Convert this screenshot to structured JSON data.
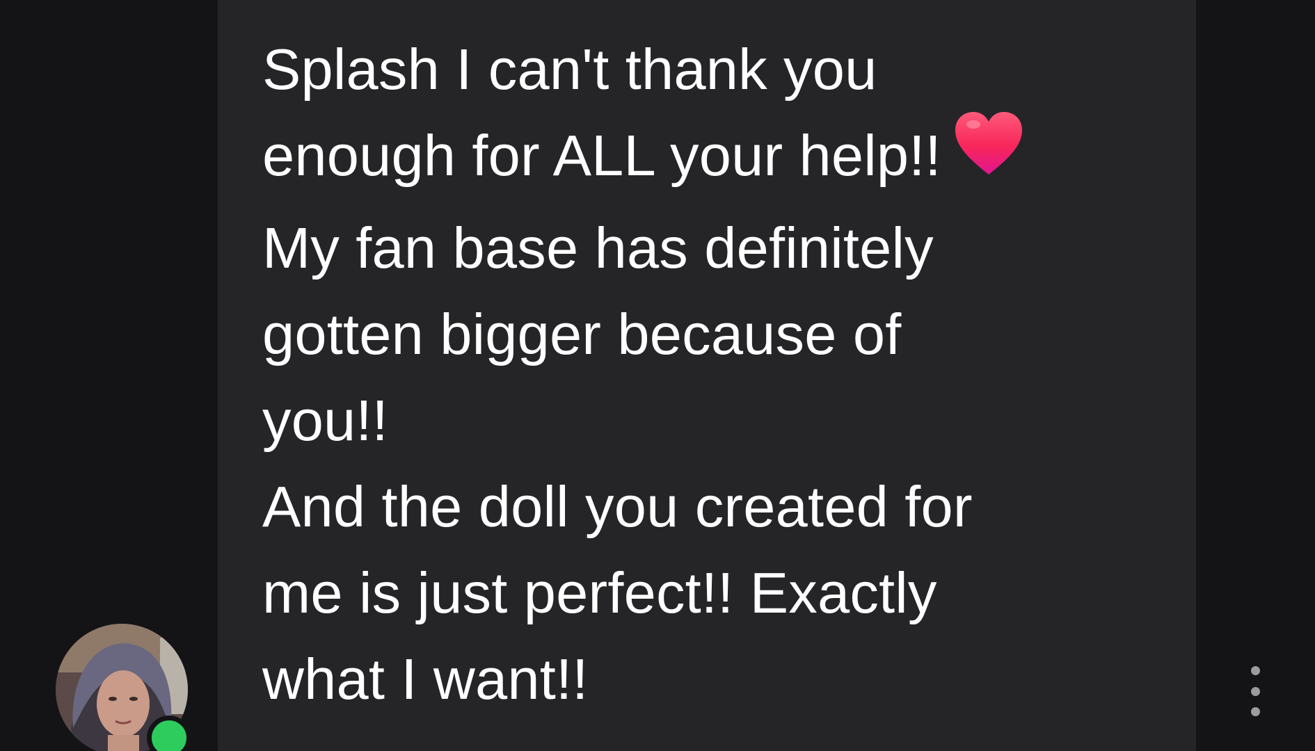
{
  "message": {
    "lines": [
      "Splash I can't thank you",
      "enough for ALL your help!!",
      "My fan base has definitely",
      "gotten bigger because of",
      "you!!",
      "And the doll you created for",
      "me is just perfect!! Exactly",
      "what I want!!"
    ],
    "emoji": "red-heart-icon"
  },
  "sender": {
    "avatar_icon": "user-avatar",
    "online_status_color": "#2ecc5c"
  },
  "actions": {
    "more_icon": "more-vertical-icon"
  }
}
